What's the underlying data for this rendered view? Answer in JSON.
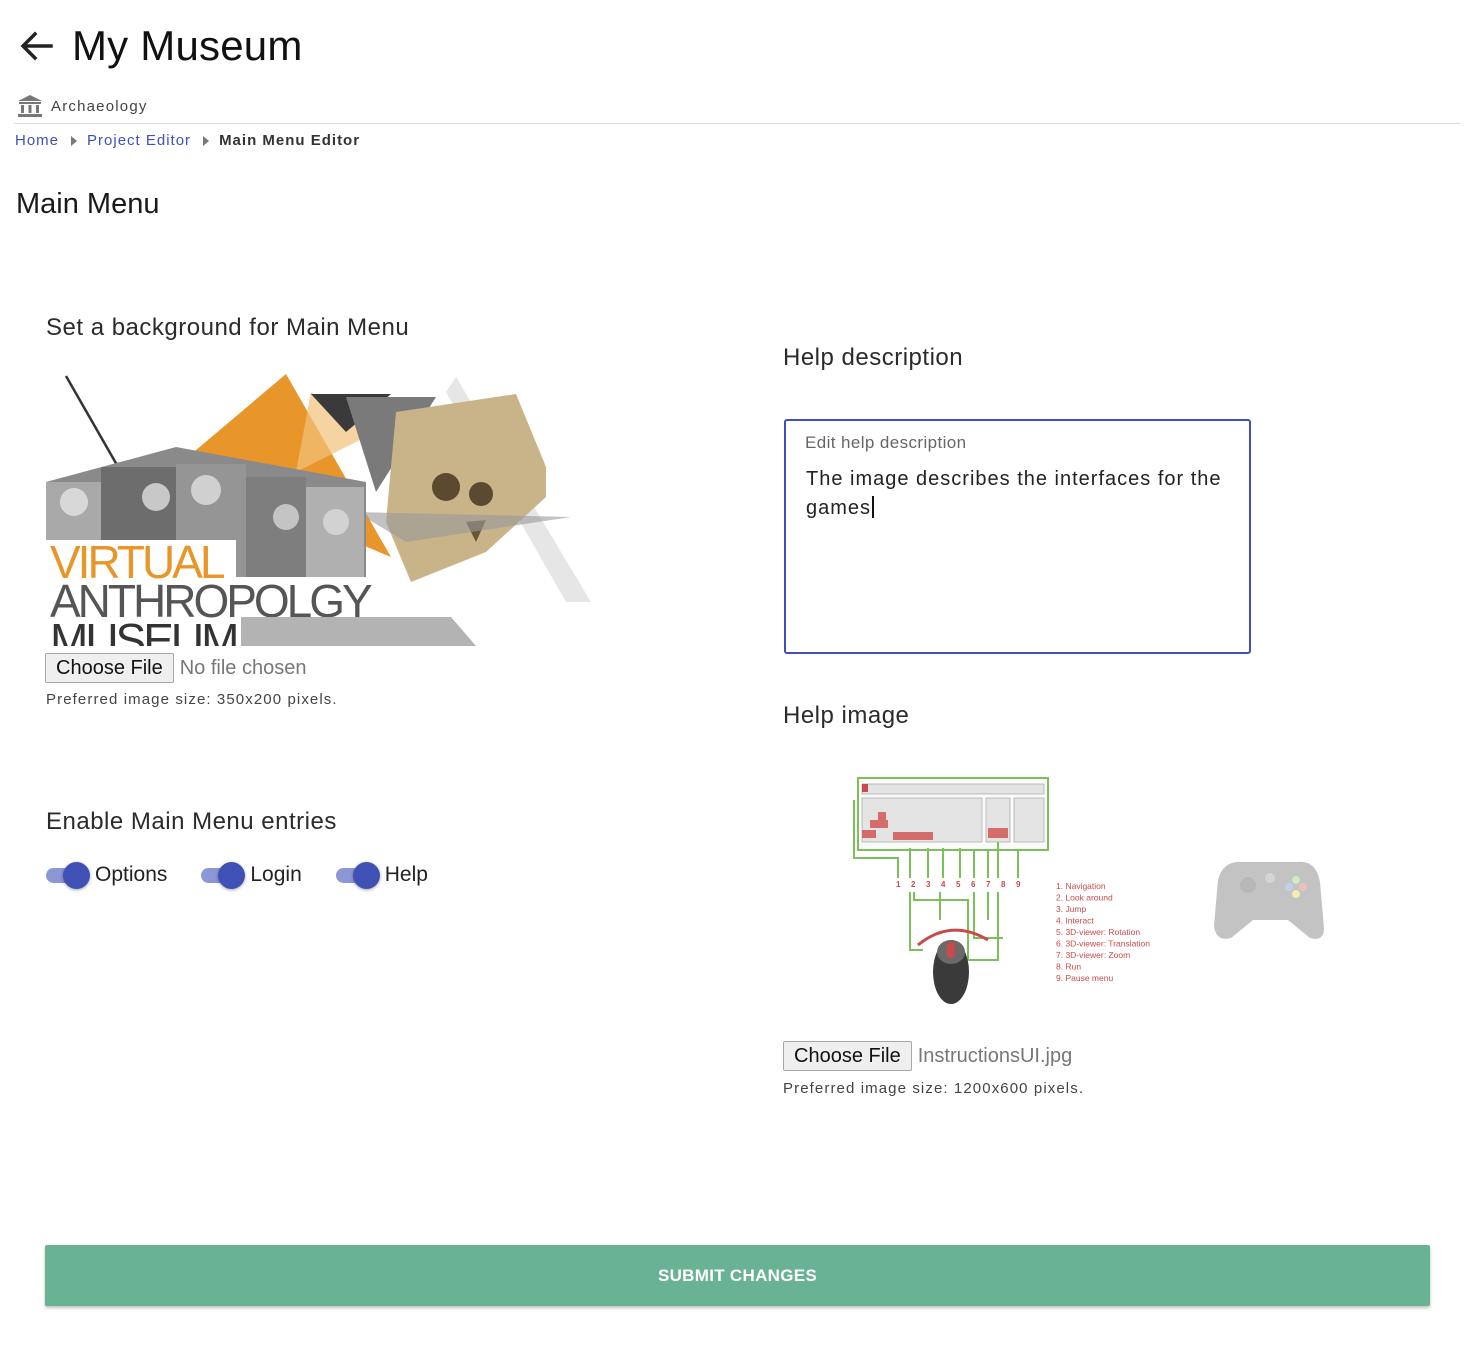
{
  "header": {
    "title": "My Museum",
    "subtitle": "Archaeology"
  },
  "breadcrumb": {
    "items": [
      "Home",
      "Project Editor"
    ],
    "current": "Main Menu Editor"
  },
  "page_title": "Main Menu",
  "background_section": {
    "heading": "Set a background for Main Menu",
    "image_text": [
      "VIRTUAL",
      "ANTHROPOLGY",
      "MUSEUM"
    ],
    "file_button": "Choose File",
    "file_status": "No file chosen",
    "hint": "Preferred image size: 350x200 pixels."
  },
  "entries_section": {
    "heading": "Enable Main Menu entries",
    "toggles": [
      {
        "label": "Options",
        "enabled": true
      },
      {
        "label": "Login",
        "enabled": true
      },
      {
        "label": "Help",
        "enabled": true
      }
    ]
  },
  "help_description": {
    "heading": "Help description",
    "field_label": "Edit help description",
    "value": "The image describes the interfaces for the games"
  },
  "help_image": {
    "heading": "Help image",
    "key_numbers": [
      "1",
      "2",
      "3",
      "4",
      "5",
      "6",
      "7",
      "8",
      "9"
    ],
    "legend": [
      "1. Navigation",
      "2. Look around",
      "3. Jump",
      "4. Interact",
      "5. 3D-viewer: Rotation",
      "6. 3D-viewer: Translation",
      "7. 3D-viewer: Zoom",
      "8. Run",
      "9. Pause menu"
    ],
    "file_button": "Choose File",
    "file_status": "InstructionsUI.jpg",
    "hint": "Preferred image size: 1200x600 pixels."
  },
  "submit_label": "SUBMIT CHANGES",
  "colors": {
    "accent": "#3f51b5",
    "submit": "#69b293",
    "brand_orange": "#e8962a"
  }
}
